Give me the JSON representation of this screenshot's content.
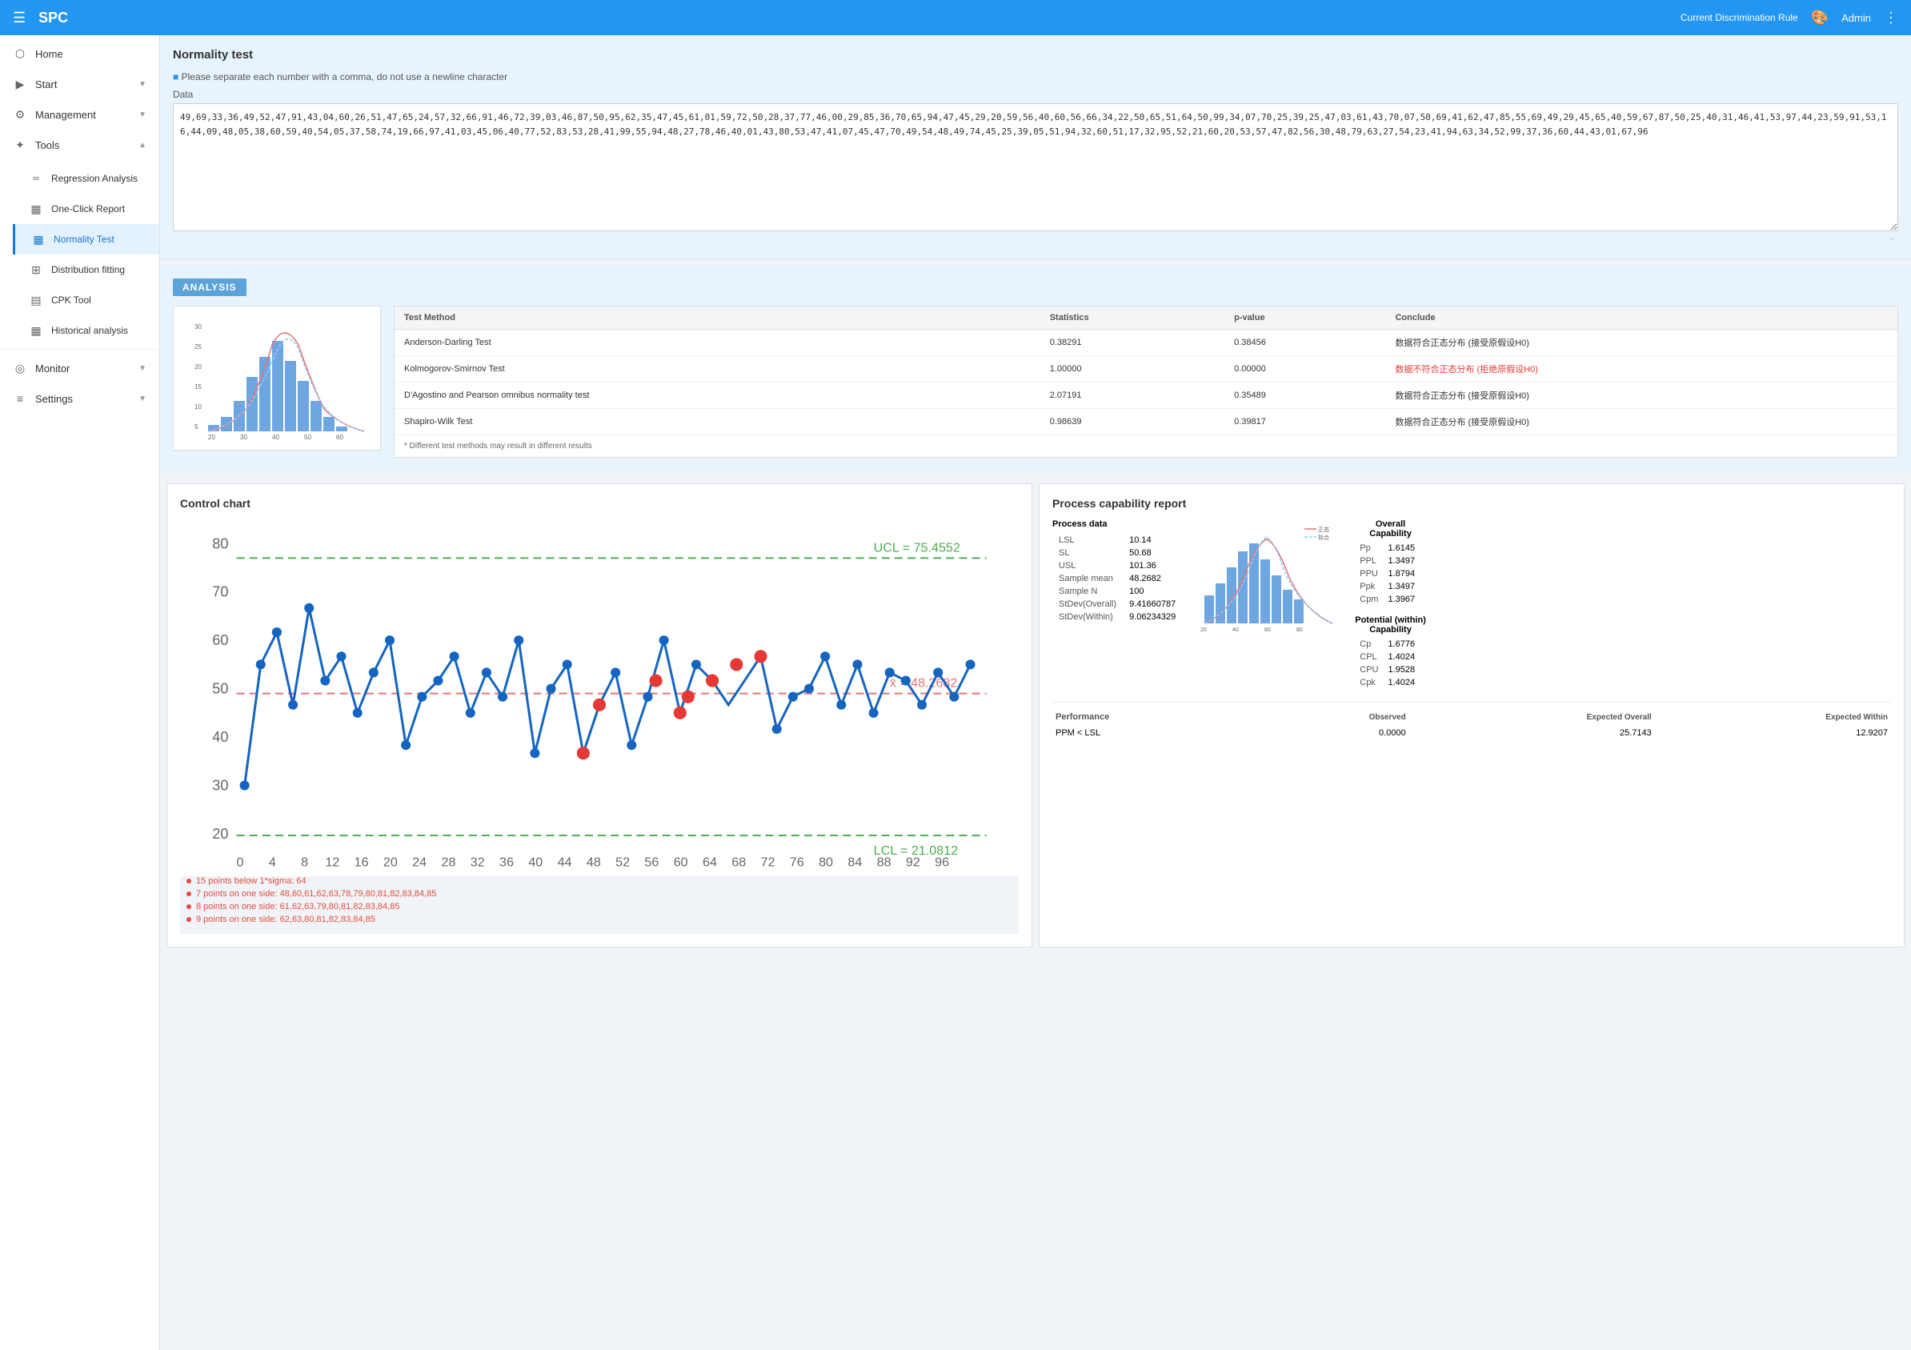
{
  "header": {
    "menu_icon": "☰",
    "title": "SPC",
    "rule": "Current Discrimination Rule",
    "palette_icon": "🎨",
    "admin": "Admin",
    "dots_icon": "⋮"
  },
  "sidebar": {
    "items": [
      {
        "id": "home",
        "label": "Home",
        "icon": "⬡",
        "has_chevron": false,
        "active": false
      },
      {
        "id": "start",
        "label": "Start",
        "icon": "▶",
        "has_chevron": true,
        "active": false
      },
      {
        "id": "management",
        "label": "Management",
        "icon": "⚙",
        "has_chevron": true,
        "active": false
      },
      {
        "id": "tools",
        "label": "Tools",
        "icon": "✦",
        "has_chevron": true,
        "active": false
      }
    ],
    "tools_sub": [
      {
        "id": "regression",
        "label": "Regression Analysis",
        "icon": "∞",
        "active": false
      },
      {
        "id": "oneclick",
        "label": "One-Click Report",
        "icon": "▦",
        "active": false
      },
      {
        "id": "normality",
        "label": "Normality Test",
        "icon": "▦",
        "active": true
      },
      {
        "id": "distribution",
        "label": "Distribution fitting",
        "icon": "⊞",
        "active": false
      },
      {
        "id": "cpk",
        "label": "CPK Tool",
        "icon": "▤",
        "active": false
      },
      {
        "id": "historical",
        "label": "Historical analysis",
        "icon": "▦",
        "active": false
      }
    ],
    "monitor": {
      "label": "Monitor",
      "icon": "◎",
      "has_chevron": true
    },
    "settings": {
      "label": "Settings",
      "icon": "≡",
      "has_chevron": true
    }
  },
  "normality_test": {
    "title": "Normality test",
    "hint": "Please separate each number with a comma, do not use a newline character",
    "data_label": "Data",
    "data_value": "49,69,33,36,49,52,47,91,43,04,60,26,51,47,65,24,57,32,66,91,46,72,39,03,46,87,50,95,62,35,47,45,61,01,59,72,50,28,37,77,46,00,29,85,36,70,65,94,47,45,29,20,59,56,40,60,56,66,34,22,50,65,51,64,50,99,34,07,70,25,39,25,47,03,61,43,70,07,50,69,41,62,47,85,55,69,49,29,45,65,40,59,67,87,50,25,40,31,46,41,53,97,44,23,59,91,53,16,44,09,48,05,38,60,59,40,54,05,37,58,74,19,66,97,41,03,45,06,40,77,52,83,53,28,41,99,55,94,48,27,78,46,40,01,43,80,53,47,41,07,45,47,70,49,54,48,49,74,45,25,39,05,51,94,32,60,51,17,32,95,52,21,60,20,53,57,47,82,56,30,48,79,63,27,54,23,41,94,63,34,52,99,37,36,60,44,43,01,67,96"
  },
  "analysis": {
    "badge": "ANALYSIS",
    "table": {
      "headers": [
        "Test Method",
        "Statistics",
        "p-value",
        "Conclude"
      ],
      "rows": [
        {
          "method": "Anderson-Darling Test",
          "statistics": "0.38291",
          "pvalue": "0.38456",
          "conclude": "数据符合正态分布 (接受原假设H0)"
        },
        {
          "method": "Kolmogorov-Smirnov Test",
          "statistics": "1.00000",
          "pvalue": "0.00000",
          "conclude": "数据不符合正态分布 (拒绝原假设H0)"
        },
        {
          "method": "D'Agostino and Pearson omnibus normality test",
          "statistics": "2.07191",
          "pvalue": "0.35489",
          "conclude": "数据符合正态分布 (接受原假设H0)"
        },
        {
          "method": "Shapiro-Wilk Test",
          "statistics": "0.98639",
          "pvalue": "0.39817",
          "conclude": "数据符合正态分布 (接受原假设H0)"
        }
      ],
      "footnote": "* Different test methods may result in different results"
    }
  },
  "control_chart": {
    "title": "Control chart",
    "ucl_label": "UCL = 75.4552",
    "mean_label": "x̄ = 48.2682",
    "lcl_label": "LCL = 21.0812",
    "ucl_value": 75.4552,
    "mean_value": 48.2682,
    "lcl_value": 21.0812,
    "y_axis": [
      "80",
      "70",
      "60",
      "50",
      "40",
      "30",
      "20"
    ],
    "x_axis": [
      "0",
      "4",
      "8",
      "12",
      "16",
      "20",
      "24",
      "28",
      "32",
      "36",
      "40",
      "44",
      "48",
      "52",
      "56",
      "60",
      "64",
      "68",
      "72",
      "76",
      "80",
      "84",
      "88",
      "92",
      "96"
    ]
  },
  "process_capability": {
    "title": "Process capability report",
    "process_data": {
      "title": "Process data",
      "rows": [
        {
          "label": "LSL",
          "value": "10.14"
        },
        {
          "label": "SL",
          "value": "50.68"
        },
        {
          "label": "USL",
          "value": "101.36"
        },
        {
          "label": "Sample mean",
          "value": "48.2682"
        },
        {
          "label": "Sample N",
          "value": "100"
        },
        {
          "label": "StDev(Overall)",
          "value": "9.41660787"
        },
        {
          "label": "StDev(Within)",
          "value": "9.06234329"
        }
      ]
    },
    "overall_capability": {
      "title": "Overall Capability",
      "rows": [
        {
          "label": "Pp",
          "value": "1.6145"
        },
        {
          "label": "PPL",
          "value": "1.3497"
        },
        {
          "label": "PPU",
          "value": "1.8794"
        },
        {
          "label": "Ppk",
          "value": "1.3497"
        },
        {
          "label": "Cpm",
          "value": "1.3967"
        }
      ]
    },
    "potential_capability": {
      "title": "Potential (within) Capability",
      "rows": [
        {
          "label": "Cp",
          "value": "1.6776"
        },
        {
          "label": "CPL",
          "value": "1.4024"
        },
        {
          "label": "CPU",
          "value": "1.9528"
        },
        {
          "label": "Cpk",
          "value": "1.4024"
        }
      ]
    },
    "performance": {
      "title": "Performance",
      "headers": [
        "Observed",
        "Expected Overall",
        "Expected Within"
      ],
      "rows": [
        {
          "label": "PPM < LSL",
          "observed": "0.0000",
          "expected_overall": "25.7143",
          "expected_within": "12.9207"
        }
      ]
    }
  },
  "alerts": [
    {
      "text": "15 points below 1*sigma: 64"
    },
    {
      "text": "7 points on one side: 48,60,61,62,63,78,79,80,81,82,83,84,85"
    },
    {
      "text": "8 points on one side: 61,62,63,79,80,81,82,83,84,85"
    },
    {
      "text": "9 points on one side: 62,63,80,81,82,83,84,85"
    }
  ]
}
